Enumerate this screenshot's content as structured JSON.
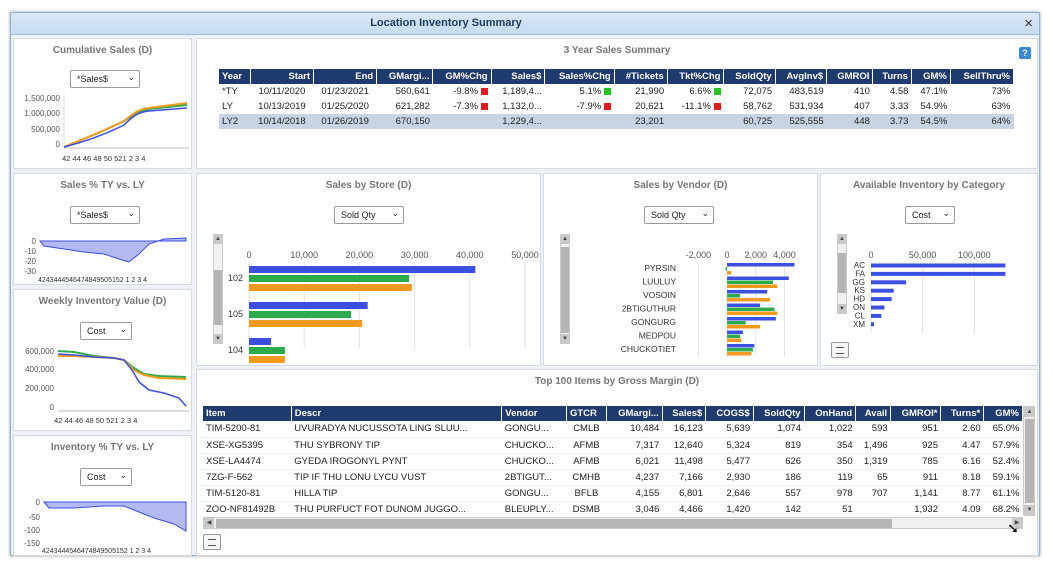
{
  "window": {
    "title": "Location Inventory Summary",
    "close_symbol": "×"
  },
  "colors": {
    "ty": "#3d4fe0",
    "ly": "#f39a1e",
    "ly2": "#2dab4c",
    "header": "#1e3a6e"
  },
  "cumulative": {
    "title": "Cumulative Sales (D)",
    "select": "*Sales$",
    "yticks": [
      "1,500,000",
      "1,000,000",
      "500,000",
      "0"
    ],
    "xticks": [
      "42",
      "44",
      "46",
      "48",
      "50",
      "52",
      "1",
      "2",
      "3",
      "4"
    ],
    "xticks_joined": "42 44 46 48 50 521 2 3 4"
  },
  "sales_pct": {
    "title": "Sales % TY vs. LY",
    "select": "*Sales$",
    "yticks": [
      "0",
      "-10",
      "-20",
      "-30"
    ],
    "xticks_joined": "4243444546474849505152 1 2 3 4"
  },
  "weekly_inv": {
    "title": "Weekly Inventory Value (D)",
    "select": "Cost",
    "yticks": [
      "600,000",
      "400,000",
      "200,000",
      "0"
    ],
    "xticks_joined": "42 44 46 48 50 521 2 3 4"
  },
  "inv_pct": {
    "title": "Inventory % TY vs. LY",
    "select": "Cost",
    "yticks": [
      "0",
      "-50",
      "-100",
      "-150"
    ],
    "xticks_joined": "4243444546474849505152 1 2 3 4"
  },
  "summary": {
    "title": "3 Year Sales Summary",
    "headers": [
      "Year",
      "Start",
      "End",
      "GMargi...",
      "GM%Chg",
      "Sales$",
      "Sales%Chg",
      "#Tickets",
      "Tkt%Chg",
      "SoldQty",
      "AvgInv$",
      "GMROI",
      "Turns",
      "GM%",
      "SellThru%"
    ],
    "rows": [
      {
        "year": "*TY",
        "start": "10/11/2020",
        "end": "01/23/2021",
        "gm": "560,641",
        "gmchg": "-9.8%",
        "gmchg_color": "#e01b1b",
        "sales": "1,189,4...",
        "saleschg": "5.1%",
        "saleschg_color": "#22c322",
        "tickets": "21,990",
        "tktchg": "6.6%",
        "tktchg_color": "#22c322",
        "soldqty": "72,075",
        "avginv": "483,519",
        "gmroi": "410",
        "turns": "4.58",
        "gmpct": "47.1%",
        "sellthru": "73%"
      },
      {
        "year": "LY",
        "start": "10/13/2019",
        "end": "01/25/2020",
        "gm": "621,282",
        "gmchg": "-7.3%",
        "gmchg_color": "#e01b1b",
        "sales": "1,132,0...",
        "saleschg": "-7.9%",
        "saleschg_color": "#e01b1b",
        "tickets": "20,621",
        "tktchg": "-11.1%",
        "tktchg_color": "#e01b1b",
        "soldqty": "58,762",
        "avginv": "531,934",
        "gmroi": "407",
        "turns": "3.33",
        "gmpct": "54.9%",
        "sellthru": "63%"
      },
      {
        "year": "LY2",
        "start": "10/14/2018",
        "end": "01/26/2019",
        "gm": "670,150",
        "gmchg": "",
        "gmchg_color": "",
        "sales": "1,229,4...",
        "saleschg": "",
        "saleschg_color": "",
        "tickets": "23,201",
        "tktchg": "",
        "tktchg_color": "",
        "soldqty": "60,725",
        "avginv": "525,555",
        "gmroi": "448",
        "turns": "3.73",
        "gmpct": "54.5%",
        "sellthru": "64%"
      }
    ]
  },
  "by_store": {
    "title": "Sales by Store (D)",
    "select": "Sold Qty",
    "xticks": [
      "0",
      "10,000",
      "20,000",
      "30,000",
      "40,000",
      "50,000"
    ],
    "stores": [
      {
        "label": "102",
        "ty": 41000,
        "ly2": 29000,
        "ly": 29500
      },
      {
        "label": "105",
        "ty": 21500,
        "ly2": 18500,
        "ly": 20500
      },
      {
        "label": "104",
        "ty": 4000,
        "ly2": 6500,
        "ly": 6500
      }
    ]
  },
  "by_vendor": {
    "title": "Sales by Vendor (D)",
    "select": "Sold Qty",
    "xticks": [
      "-2,000",
      "0",
      "2,000",
      "4,000"
    ],
    "vendors": [
      {
        "label": "PYRSIN",
        "ty": 4700,
        "ly2": -100,
        "ly": 300
      },
      {
        "label": "LUULUY",
        "ty": 4300,
        "ly2": 3200,
        "ly": 3500
      },
      {
        "label": "VOSOIN",
        "ty": 2800,
        "ly2": 900,
        "ly": 3000
      },
      {
        "label": "2BTIGUTHUR",
        "ty": 2300,
        "ly2": 3300,
        "ly": 3500
      },
      {
        "label": "GONGURG",
        "ty": 3400,
        "ly2": 1300,
        "ly": 2300
      },
      {
        "label": "MEDPOU",
        "ty": 1100,
        "ly2": 900,
        "ly": 1000
      },
      {
        "label": "CHUCKOTIET",
        "ty": 1900,
        "ly2": 1800,
        "ly": 1700
      }
    ]
  },
  "by_category": {
    "title": "Available Inventory by Category",
    "select": "Cost",
    "xticks": [
      "0",
      "50,000",
      "100,000"
    ],
    "categories": [
      {
        "label": "AC",
        "value": 130000
      },
      {
        "label": "FA",
        "value": 130000
      },
      {
        "label": "GG",
        "value": 34000
      },
      {
        "label": "KS",
        "value": 22000
      },
      {
        "label": "HD",
        "value": 20000
      },
      {
        "label": "ON",
        "value": 13000
      },
      {
        "label": "CL",
        "value": 10000
      },
      {
        "label": "XM",
        "value": 3000
      }
    ]
  },
  "top100": {
    "title": "Top 100 Items by Gross Margin (D)",
    "headers": [
      "Item",
      "Descr",
      "Vendor",
      "GTCR",
      "GMargi...",
      "Sales$",
      "COGS$",
      "SoldQty",
      "OnHand",
      "Avail",
      "GMROI*",
      "Turns*",
      "GM%"
    ],
    "rows": [
      [
        "TIM-5200-81",
        "UVURADYA NUCUSSOTA LING SLUU...",
        "GONGU...",
        "CMLB",
        "10,484",
        "16,123",
        "5,639",
        "1,074",
        "1,022",
        "593",
        "951",
        "2.60",
        "65.0%"
      ],
      [
        "XSE-XG5395",
        "THU SYBRONY TIP",
        "CHUCKO...",
        "AFMB",
        "7,317",
        "12,640",
        "5,324",
        "819",
        "354",
        "1,496",
        "925",
        "4.47",
        "57.9%"
      ],
      [
        "XSE-LA4474",
        "GYEDA IROGONYL PYNT",
        "CHUCKO...",
        "AFMB",
        "6,021",
        "11,498",
        "5,477",
        "626",
        "350",
        "1,319",
        "785",
        "6.16",
        "52.4%"
      ],
      [
        "7ZG-F-562",
        "TIP IF THU LONU LYCU VUST",
        "2BTIGUT...",
        "CMHB",
        "4,237",
        "7,166",
        "2,930",
        "186",
        "119",
        "65",
        "911",
        "8.18",
        "59.1%"
      ],
      [
        "TIM-5120-81",
        "HILLA TIP",
        "GONGU...",
        "BFLB",
        "4,155",
        "6,801",
        "2,646",
        "557",
        "978",
        "707",
        "1,141",
        "8.77",
        "61.1%"
      ],
      [
        "ZOO-NF81492B",
        "THU PURFUCT FOT DUNOM JUGGO...",
        "BLEUPLY...",
        "DSMB",
        "3,046",
        "4,466",
        "1,420",
        "142",
        "51",
        "",
        "1,932",
        "4.09",
        "68.2%"
      ]
    ]
  }
}
